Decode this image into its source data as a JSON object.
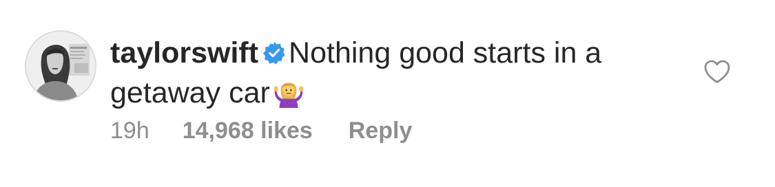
{
  "comment": {
    "username": "taylorswift",
    "verified": true,
    "text_line1": "Nothing good starts in a",
    "text_line2": "getaway car",
    "emoji": "person-shrugging-emoji",
    "timestamp": "19h",
    "likes": "14,968 likes",
    "reply_label": "Reply",
    "like_icon": "heart-outline-icon",
    "colors": {
      "text": "#262626",
      "meta": "#8e8e8e",
      "verified_badge": "#3897f0"
    }
  }
}
